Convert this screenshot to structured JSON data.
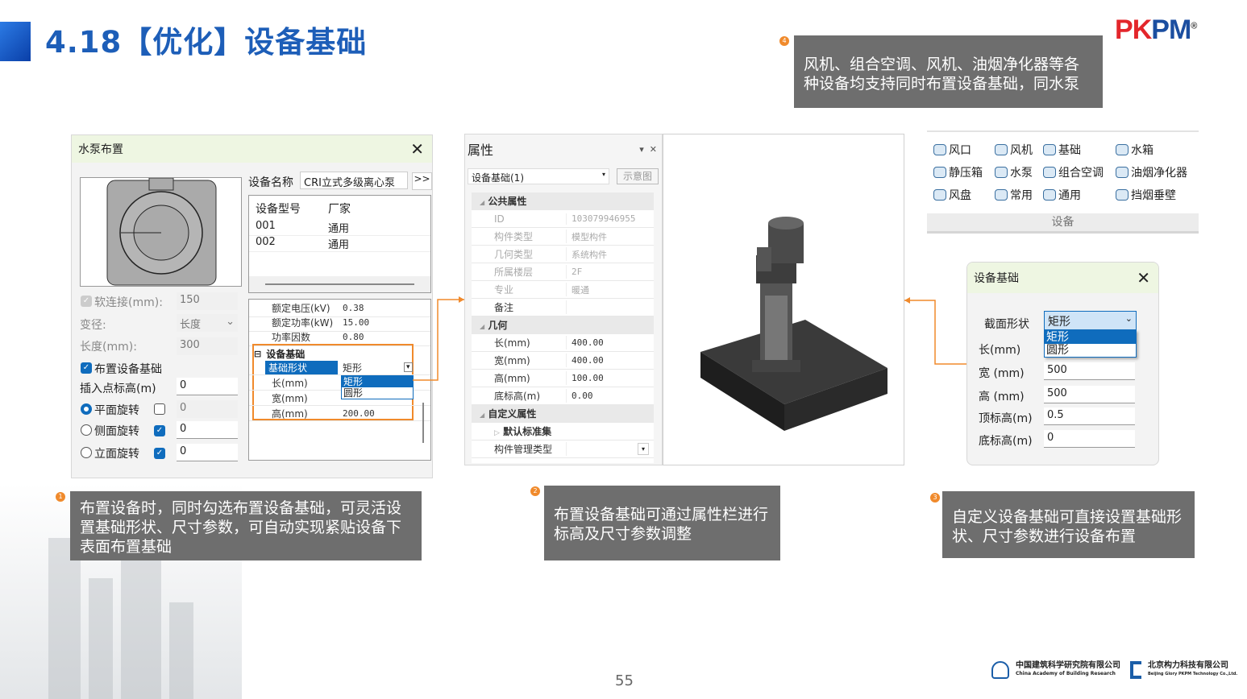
{
  "header": {
    "title": "4.18【优化】设备基础",
    "logo": "PKPM",
    "logo_mark": "®"
  },
  "callouts": [
    {
      "num": "1",
      "text": "布置设备时，同时勾选布置设备基础，可灵活设置基础形状、尺寸参数，可自动实现紧贴设备下表面布置基础"
    },
    {
      "num": "2",
      "text": "布置设备基础可通过属性栏进行标高及尺寸参数调整"
    },
    {
      "num": "3",
      "text": "自定义设备基础可直接设置基础形状、尺寸参数进行设备布置"
    },
    {
      "num": "4",
      "text": "风机、组合空调、风机、油烟净化器等各种设备均支持同时布置设备基础，同水泵"
    }
  ],
  "pump_dialog": {
    "title": "水泵布置",
    "device_name_label": "设备名称",
    "device_name_value": "CRI立式多级离心泵",
    "more_button": ">>",
    "table_headers": [
      "设备型号",
      "厂家"
    ],
    "table_rows": [
      [
        "001",
        "通用"
      ],
      [
        "002",
        "通用"
      ]
    ],
    "soft_conn_label": "软连接(mm):",
    "soft_conn_value": "150",
    "reducer_label": "变径:",
    "reducer_value": "长度",
    "length_label": "长度(mm):",
    "length_value": "300",
    "place_base_label": "布置设备基础",
    "insert_elev_label": "插入点标高(m)",
    "insert_elev_value": "0",
    "rotations": [
      {
        "label": "平面旋转",
        "value": "0"
      },
      {
        "label": "侧面旋转",
        "value": "0"
      },
      {
        "label": "立面旋转",
        "value": "0"
      }
    ],
    "props": [
      {
        "k": "额定电压(kV)",
        "v": "0.38"
      },
      {
        "k": "额定功率(kW)",
        "v": "15.00"
      },
      {
        "k": "功率因数",
        "v": "0.80"
      }
    ],
    "base_section": "设备基础",
    "base_props": [
      {
        "k": "基础形状",
        "v": "矩形"
      },
      {
        "k": "长(mm)",
        "v": ""
      },
      {
        "k": "宽(mm)",
        "v": ""
      },
      {
        "k": "高(mm)",
        "v": "200.00"
      }
    ],
    "shape_options": [
      "矩形",
      "圆形"
    ]
  },
  "properties_panel": {
    "title": "属性",
    "selector": "设备基础(1)",
    "diagram_button": "示意图",
    "sections": [
      {
        "name": "公共属性",
        "rows": [
          {
            "k": "ID",
            "v": "103079946955"
          },
          {
            "k": "构件类型",
            "v": "模型构件"
          },
          {
            "k": "几何类型",
            "v": "系统构件"
          },
          {
            "k": "所属楼层",
            "v": "2F"
          },
          {
            "k": "专业",
            "v": "暖通"
          },
          {
            "k": "备注",
            "v": ""
          }
        ]
      },
      {
        "name": "几何",
        "rows": [
          {
            "k": "长(mm)",
            "v": "400.00"
          },
          {
            "k": "宽(mm)",
            "v": "400.00"
          },
          {
            "k": "高(mm)",
            "v": "100.00"
          },
          {
            "k": "底标高(m)",
            "v": "0.00"
          }
        ]
      },
      {
        "name": "自定义属性",
        "sub": "默认标准集",
        "rows": [
          {
            "k": "构件管理类型",
            "v": ""
          }
        ]
      }
    ]
  },
  "ribbon": {
    "items": [
      "风口",
      "风机",
      "基础",
      "水箱",
      "静压箱",
      "水泵",
      "组合空调",
      "油烟净化器",
      "风盘",
      "常用",
      "通用",
      "挡烟垂壁"
    ],
    "group": "设备"
  },
  "base_dialog": {
    "title": "设备基础",
    "shape_label": "截面形状",
    "shape_value": "矩形",
    "shape_options": [
      "矩形",
      "圆形"
    ],
    "fields": [
      {
        "label": "长(mm)",
        "value": ""
      },
      {
        "label": "宽 (mm)",
        "value": "500"
      },
      {
        "label": "高 (mm)",
        "value": "500"
      },
      {
        "label": "顶标高(m)",
        "value": "0.5"
      },
      {
        "label": "底标高(m)",
        "value": "0"
      }
    ]
  },
  "footer": {
    "page": "55",
    "org1_cn": "中国建筑科学研究院有限公司",
    "org1_en": "China Academy of Building Research",
    "org2_cn": "北京构力科技有限公司",
    "org2_en": "Beijing Glory PKPM Technology Co.,Ltd."
  },
  "colors": {
    "accent": "#1d5eb8",
    "orange": "#f08a2c",
    "callout_bg": "#6e6e6e",
    "select": "#0f6cbd"
  }
}
